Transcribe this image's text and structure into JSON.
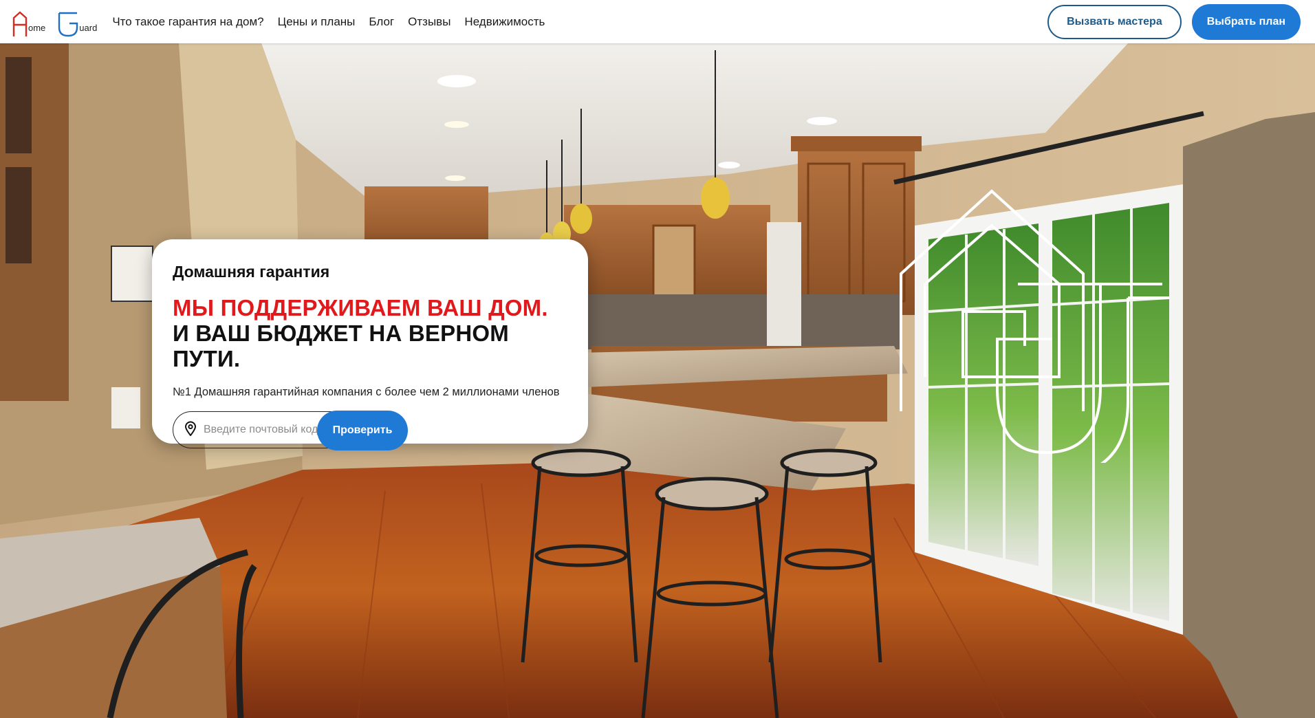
{
  "brand": {
    "home_word": "ome",
    "guard_word": "uard",
    "home_color": "#d62b22",
    "guard_color": "#1f6fc4"
  },
  "nav": {
    "links": [
      "Что такое гарантия на дом?",
      "Цены и планы",
      "Блог",
      "Отзывы",
      "Недвижимость"
    ],
    "call_master_label": "Вызвать мастера",
    "choose_plan_label": "Выбрать план"
  },
  "hero": {
    "eyebrow": "Домашняя гарантия",
    "title_red": "МЫ ПОДДЕРЖИВАЕМ ВАШ ДОМ.",
    "title_black": "И ВАШ БЮДЖЕТ НА ВЕРНОМ ПУТИ.",
    "subtitle": "№1 Домашняя гарантийная компания с более чем 2 миллионами членов",
    "zip_placeholder": "Введите почтовый код",
    "check_label": "Проверить",
    "accent_red": "#e0191c",
    "accent_blue": "#1f7ad6"
  },
  "icons": {
    "location": "location-pin-icon",
    "watermark": "home-guard-watermark-icon"
  }
}
